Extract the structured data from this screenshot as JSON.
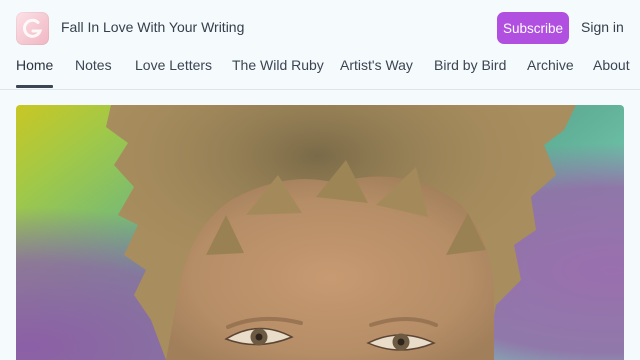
{
  "header": {
    "site_title": "Fall In Love With Your Writing",
    "logo_icon": "g-logo-icon",
    "subscribe_label": "Subscribe",
    "signin_label": "Sign in"
  },
  "nav": {
    "items": [
      {
        "label": "Home",
        "active": true
      },
      {
        "label": "Notes"
      },
      {
        "label": "Love Letters"
      },
      {
        "label": "The Wild Ruby"
      },
      {
        "label": "Artist's Way"
      },
      {
        "label": "Bird by Bird"
      },
      {
        "label": "Archive"
      },
      {
        "label": "About"
      }
    ]
  },
  "hero": {
    "image_subject": "painted-portrait"
  },
  "colors": {
    "accent": "#b04fe0",
    "background": "#f5fafd",
    "text": "#36404c"
  }
}
